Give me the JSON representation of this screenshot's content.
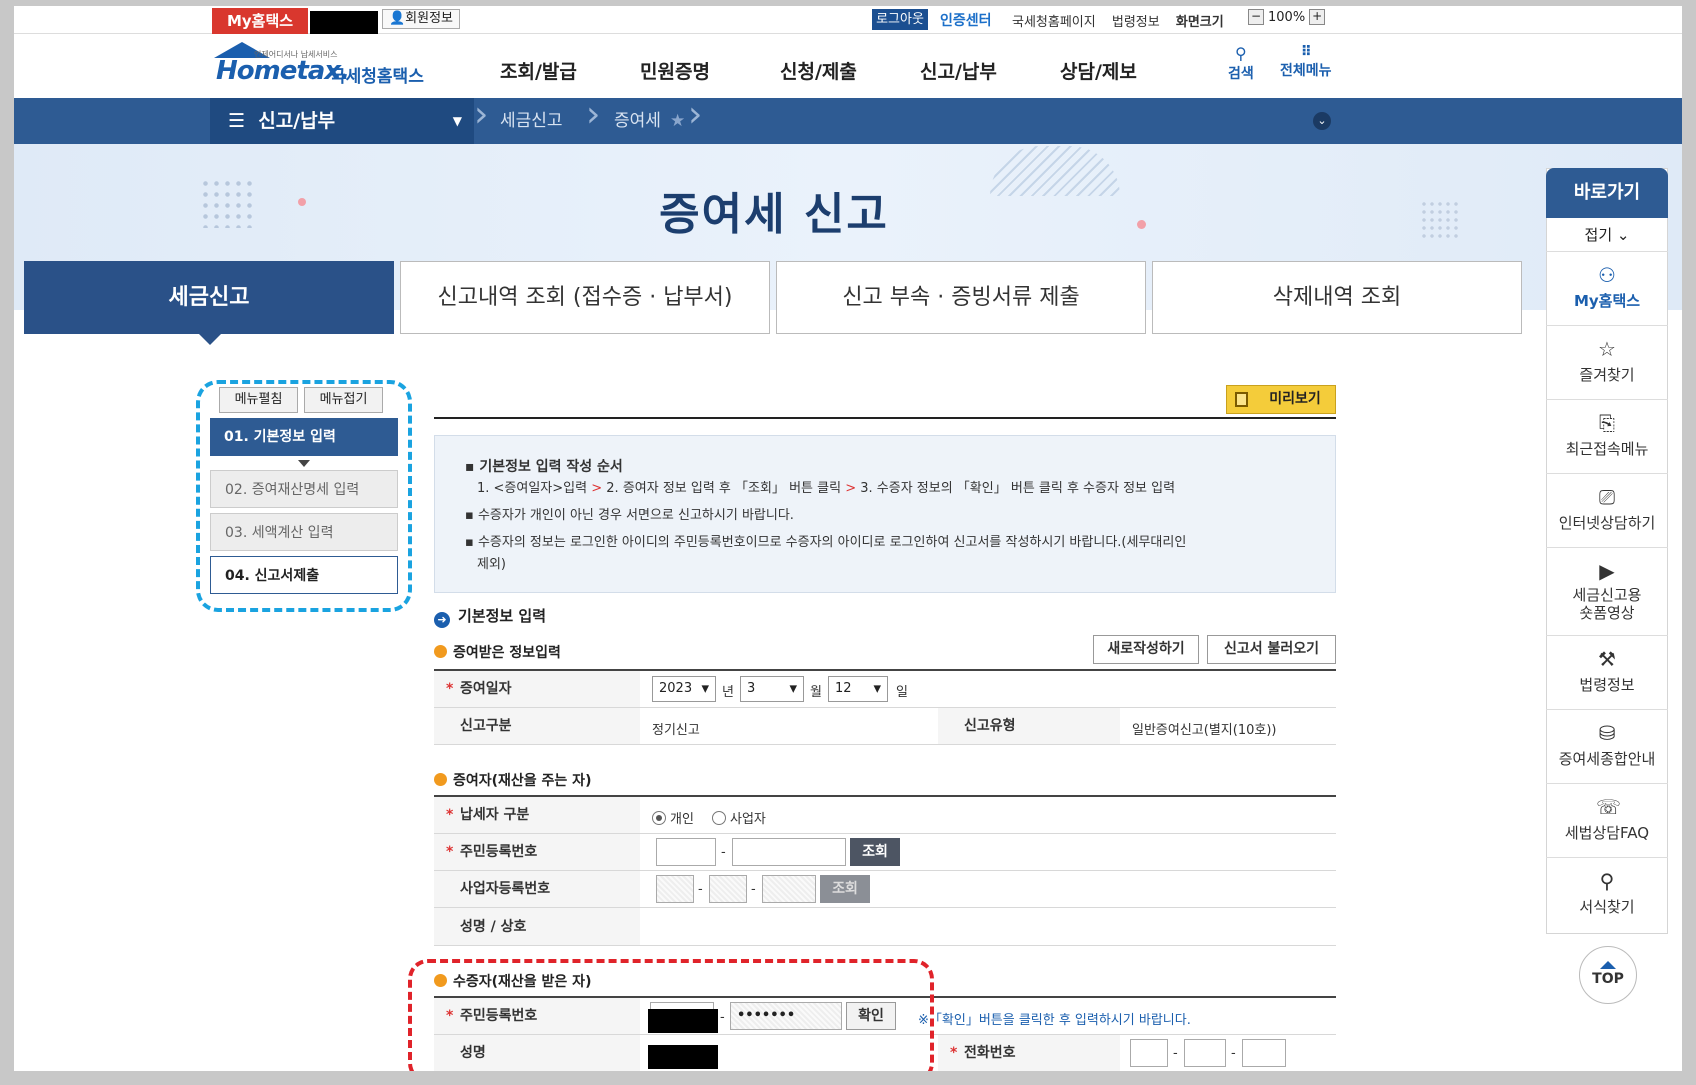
{
  "util": {
    "my_hometax": "My홈택스",
    "member_info": "회원정보",
    "logout": "로그아웃",
    "cert_center": "인증센터",
    "links": [
      "국세청홈페이지",
      "법령정보",
      "화면크기"
    ],
    "zoom": "100%"
  },
  "logo": {
    "sub": "언제어디서나 납세서비스",
    "name": "Hometax.",
    "kor": "국세청홈택스"
  },
  "gnb": [
    "조회/발급",
    "민원증명",
    "신청/제출",
    "신고/납부",
    "상담/제보"
  ],
  "header_right": {
    "search": "검색",
    "all_menu": "전체메뉴"
  },
  "breadcrumb": {
    "menu": "신고/납부",
    "level1": "세금신고",
    "level2": "증여세"
  },
  "page_title": "증여세 신고",
  "tabs": [
    "세금신고",
    "신고내역 조회 (접수증 · 납부서)",
    "신고 부속 · 증빙서류 제출",
    "삭제내역 조회"
  ],
  "side_steps": {
    "expand": "메뉴펼침",
    "collapse": "메뉴접기",
    "steps": [
      "01. 기본정보 입력",
      "02. 증여재산명세 입력",
      "03. 세액계산 입력",
      "04. 신고서제출"
    ]
  },
  "preview_label": "미리보기",
  "notice": {
    "heading": "기본정보 입력 작성 순서",
    "steps_a": "1. <증여일자>입력",
    "steps_b": "2. 증여자 정보 입력 후 「조회」 버튼 클릭",
    "steps_c": "3. 수증자 정보의 「확인」 버튼 클릭 후 수증자 정보 입력",
    "gt": ">",
    "line2": "수증자가 개인이 아닌 경우 서면으로 신고하시기 바랍니다.",
    "line3": "수증자의 정보는 로그인한 아이디의 주민등록번호이므로 수증자의 아이디로 로그인하여 신고서를 작성하시기 바랍니다.(세무대리인",
    "line3b": "제외)"
  },
  "section_title": "기본정보 입력",
  "received": {
    "title": "증여받은 정보입력",
    "new_btn": "새로작성하기",
    "load_btn": "신고서 불러오기",
    "date_label": "증여일자",
    "year": "2023",
    "year_unit": "년",
    "month": "3",
    "month_unit": "월",
    "day": "12",
    "day_unit": "일",
    "report_type_label": "신고구분",
    "report_type": "정기신고",
    "report_kind_label": "신고유형",
    "report_kind": "일반증여신고(별지(10호))"
  },
  "donor": {
    "title": "증여자(재산을 주는 자)",
    "taxpayer_label": "납세자 구분",
    "opt_individual": "개인",
    "opt_business": "사업자",
    "rrn_label": "주민등록번호",
    "lookup": "조회",
    "brn_label": "사업자등록번호",
    "lookup_disabled": "조회",
    "name_label": "성명 / 상호",
    "dash": "-"
  },
  "recipient": {
    "title": "수증자(재산을 받은 자)",
    "rrn_label": "주민등록번호",
    "rrn_masked": "•••••••",
    "confirm": "확인",
    "hint": "※「확인」버튼을 클릭한 후 입력하시기 바랍니다.",
    "name_label": "성명",
    "phone_label": "전화번호"
  },
  "quick": {
    "head": "바로가기",
    "fold": "접기",
    "items": [
      {
        "label": "My홈택스",
        "icon": "user-icon"
      },
      {
        "label": "즐겨찾기",
        "icon": "star-icon"
      },
      {
        "label": "최근접속메뉴",
        "icon": "recent-search-icon"
      },
      {
        "label": "인터넷상담하기",
        "icon": "laptop-icon"
      },
      {
        "label": "세금신고용",
        "label2": "숏폼영상",
        "icon": "play-icon"
      },
      {
        "label": "법령정보",
        "icon": "gavel-icon"
      },
      {
        "label": "증여세종합안내",
        "icon": "coins-icon"
      },
      {
        "label": "세법상담FAQ",
        "icon": "chat-icon"
      },
      {
        "label": "서식찾기",
        "icon": "search-icon"
      }
    ],
    "top": "TOP"
  }
}
